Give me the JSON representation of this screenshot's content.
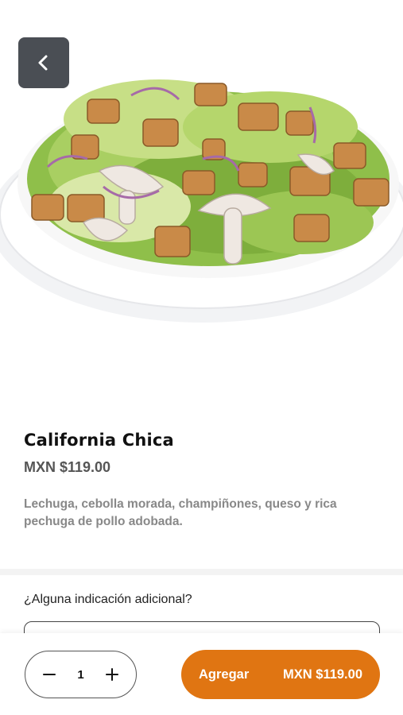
{
  "product": {
    "name": "California Chica",
    "price": "MXN $119.00",
    "description": "Lechuga, cebolla morada, champiñones, queso y rica pechuga de pollo adobada.",
    "image_icon": "salad-bowl-photo"
  },
  "navigation": {
    "back_icon": "chevron-left-icon"
  },
  "notes": {
    "label": "¿Alguna indicación adicional?",
    "placeholder": ""
  },
  "cart": {
    "quantity": "1",
    "add_label": "Agregar",
    "add_price": "MXN $119.00",
    "accent_color": "#e07512"
  }
}
